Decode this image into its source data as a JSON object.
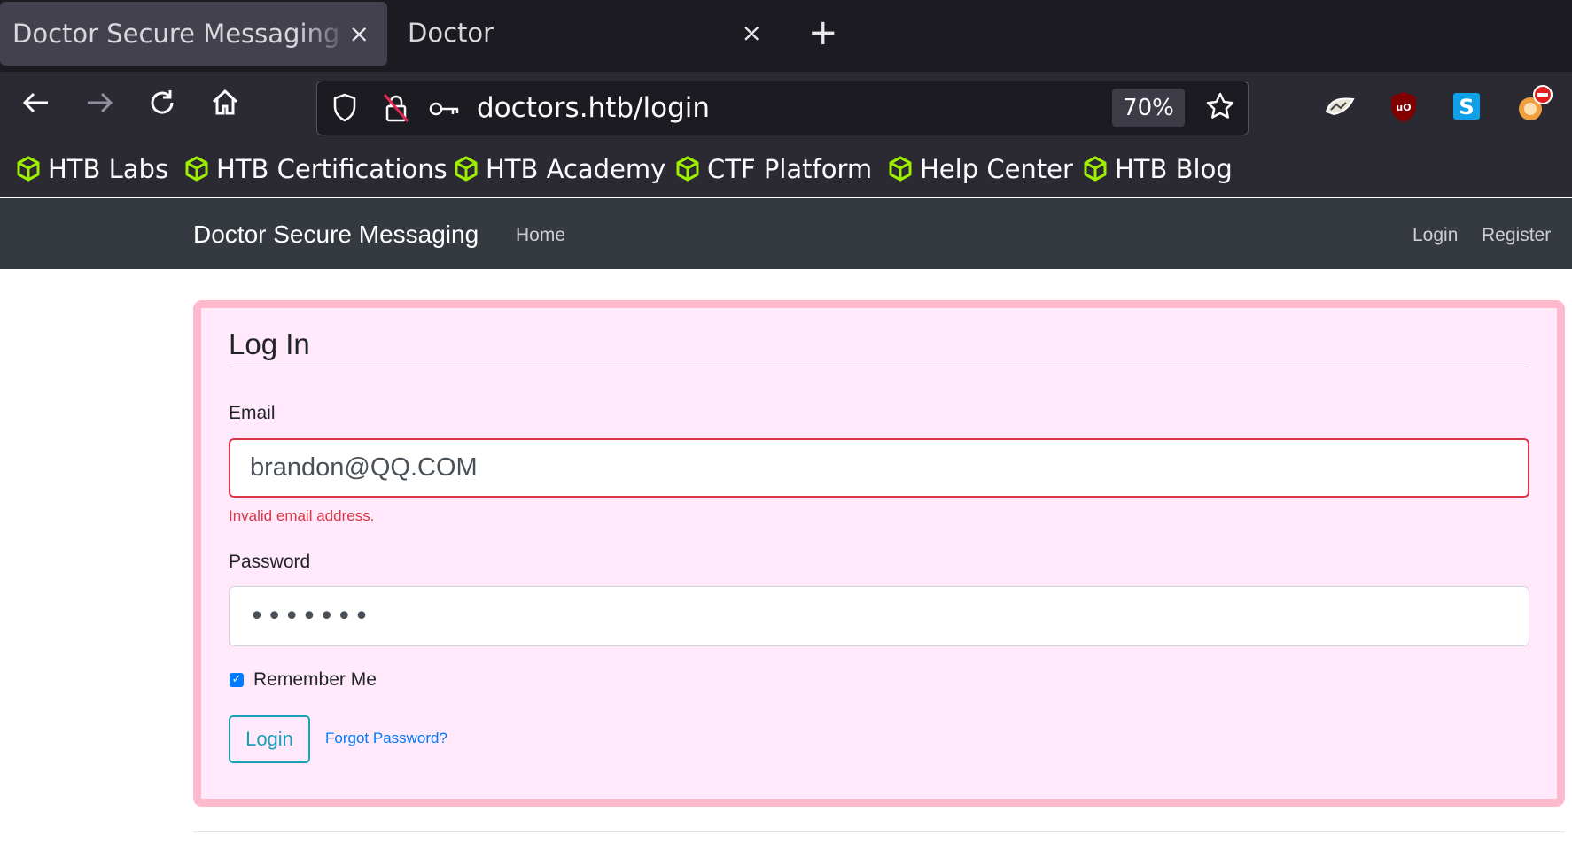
{
  "browser": {
    "tabs": [
      {
        "title": "Doctor Secure Messaging - Lo",
        "close": "×"
      },
      {
        "title": "Doctor",
        "close": "×"
      }
    ],
    "new_tab": "+",
    "url": "doctors.htb/login",
    "zoom": "70%",
    "bookmarks": [
      "HTB Labs",
      "HTB Certifications",
      "HTB Academy",
      "CTF Platform",
      "Help Center",
      "HTB Blog"
    ],
    "bookmark_color": "#9fef00",
    "extensions": [
      "foxyproxy-icon",
      "ublock-icon",
      "skype-icon",
      "adblock-icon"
    ]
  },
  "site": {
    "brand": "Doctor Secure Messaging",
    "nav": {
      "home": "Home",
      "login": "Login",
      "register": "Register"
    }
  },
  "form": {
    "legend": "Log In",
    "email_label": "Email",
    "email_value": "brandon@QQ.COM",
    "email_error": "Invalid email address.",
    "password_label": "Password",
    "password_value": "•••••••",
    "remember_label": "Remember Me",
    "remember_checked": true,
    "login_button": "Login",
    "forgot_link": "Forgot Password?"
  },
  "colors": {
    "card_background": "#ffe9fb",
    "card_border": "#ffb9cc",
    "error": "#dc3545",
    "button": "#17a2b8",
    "link": "#007bff"
  }
}
